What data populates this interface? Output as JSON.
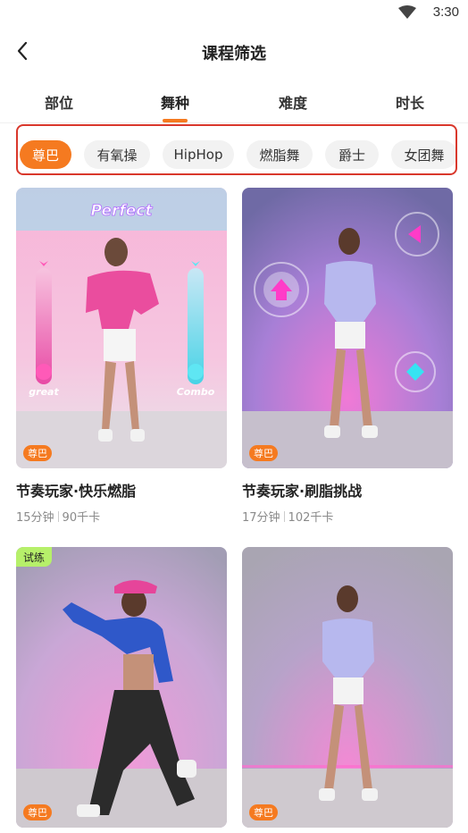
{
  "status_bar": {
    "time": "3:30",
    "wifi_icon": "wifi-icon"
  },
  "header": {
    "title": "课程筛选",
    "back_icon": "back-arrow-icon"
  },
  "tabs": [
    {
      "label": "部位",
      "active": false
    },
    {
      "label": "舞种",
      "active": true
    },
    {
      "label": "难度",
      "active": false
    },
    {
      "label": "时长",
      "active": false
    }
  ],
  "chips": [
    {
      "label": "尊巴",
      "active": true
    },
    {
      "label": "有氧操",
      "active": false
    },
    {
      "label": "HipHop",
      "active": false
    },
    {
      "label": "燃脂舞",
      "active": false
    },
    {
      "label": "爵士",
      "active": false
    },
    {
      "label": "女团舞",
      "active": false
    }
  ],
  "cards": [
    {
      "title": "节奏玩家·快乐燃脂",
      "duration": "15分钟",
      "calories": "90千卡",
      "badge": "尊巴",
      "trial": "",
      "overlay_text_top": "Perfect",
      "overlay_text_left": "great",
      "overlay_text_right": "Combo"
    },
    {
      "title": "节奏玩家·刷脂挑战",
      "duration": "17分钟",
      "calories": "102千卡",
      "badge": "尊巴",
      "trial": ""
    },
    {
      "title": "",
      "duration": "",
      "calories": "",
      "badge": "尊巴",
      "trial": "试练"
    },
    {
      "title": "",
      "duration": "",
      "calories": "",
      "badge": "尊巴",
      "trial": ""
    }
  ],
  "colors": {
    "accent": "#f57a20",
    "highlight_border": "#d9382c",
    "trial": "#b6f06a"
  }
}
